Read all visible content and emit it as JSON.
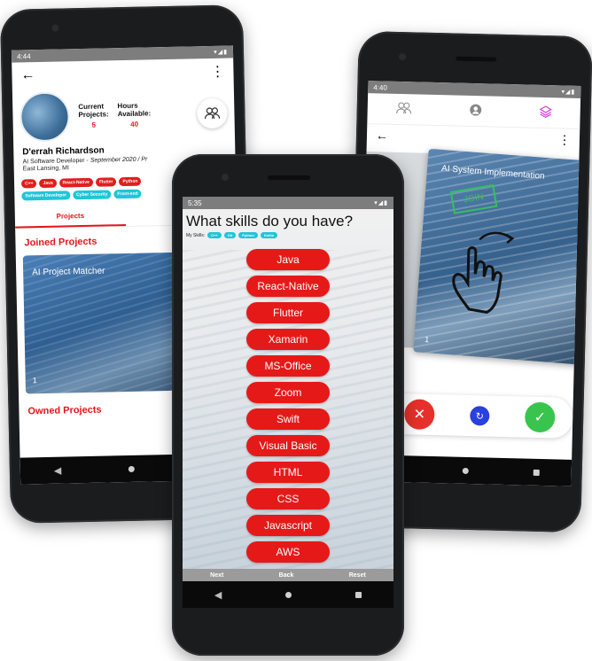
{
  "profile_screen": {
    "status_time": "4:44",
    "status_icons": "▾◢▮",
    "current_projects_label": "Current\nProjects:",
    "current_projects_value": "5",
    "hours_label": "Hours\nAvailable:",
    "hours_value": "40",
    "name": "D'errah Richardson",
    "role": "AI Software Developer - ",
    "role_dates": "September 2020 / Pr",
    "location": "East Lansing, MI",
    "skill_chips": [
      "C++",
      "Java",
      "React-Native",
      "Flutter",
      "Python"
    ],
    "interest_chips": [
      "Software Developer",
      "Cyber Security",
      "Front-end"
    ],
    "tabs": [
      "Projects",
      "Noti"
    ],
    "joined_title": "Joined Projects",
    "card_title": "AI Project Matcher",
    "card_number": "1",
    "owned_title": "Owned Projects"
  },
  "skills_screen": {
    "status_time": "5:35",
    "status_icons": "▾◢▮",
    "title": "What skills do you have?",
    "my_skills_label": "My Skills:",
    "my_skills": [
      "C++",
      "Git",
      "Python",
      "Kotlin"
    ],
    "skills": [
      "Java",
      "React-Native",
      "Flutter",
      "Xamarin",
      "MS-Office",
      "Zoom",
      "Swift",
      "Visual Basic",
      "HTML",
      "CSS",
      "Javascript",
      "AWS"
    ],
    "actions": {
      "next": "Next",
      "back": "Back",
      "reset": "Reset"
    }
  },
  "swipe_screen": {
    "status_time": "4:40",
    "status_icons": "▾◢▮",
    "card_title": "AI System Implementation",
    "stamp": "JOIN",
    "card_number": "1"
  },
  "icons": {
    "back_arrow": "←",
    "overflow": "⋮",
    "team": "people-icon",
    "reject": "✕",
    "undo": "↻",
    "accept": "✓"
  },
  "colors": {
    "accent_red": "#e61919",
    "chip_cyan": "#20c5d8",
    "accept_green": "#39c54d",
    "undo_blue": "#2a40e0",
    "tab_magenta": "#d63fe0"
  }
}
